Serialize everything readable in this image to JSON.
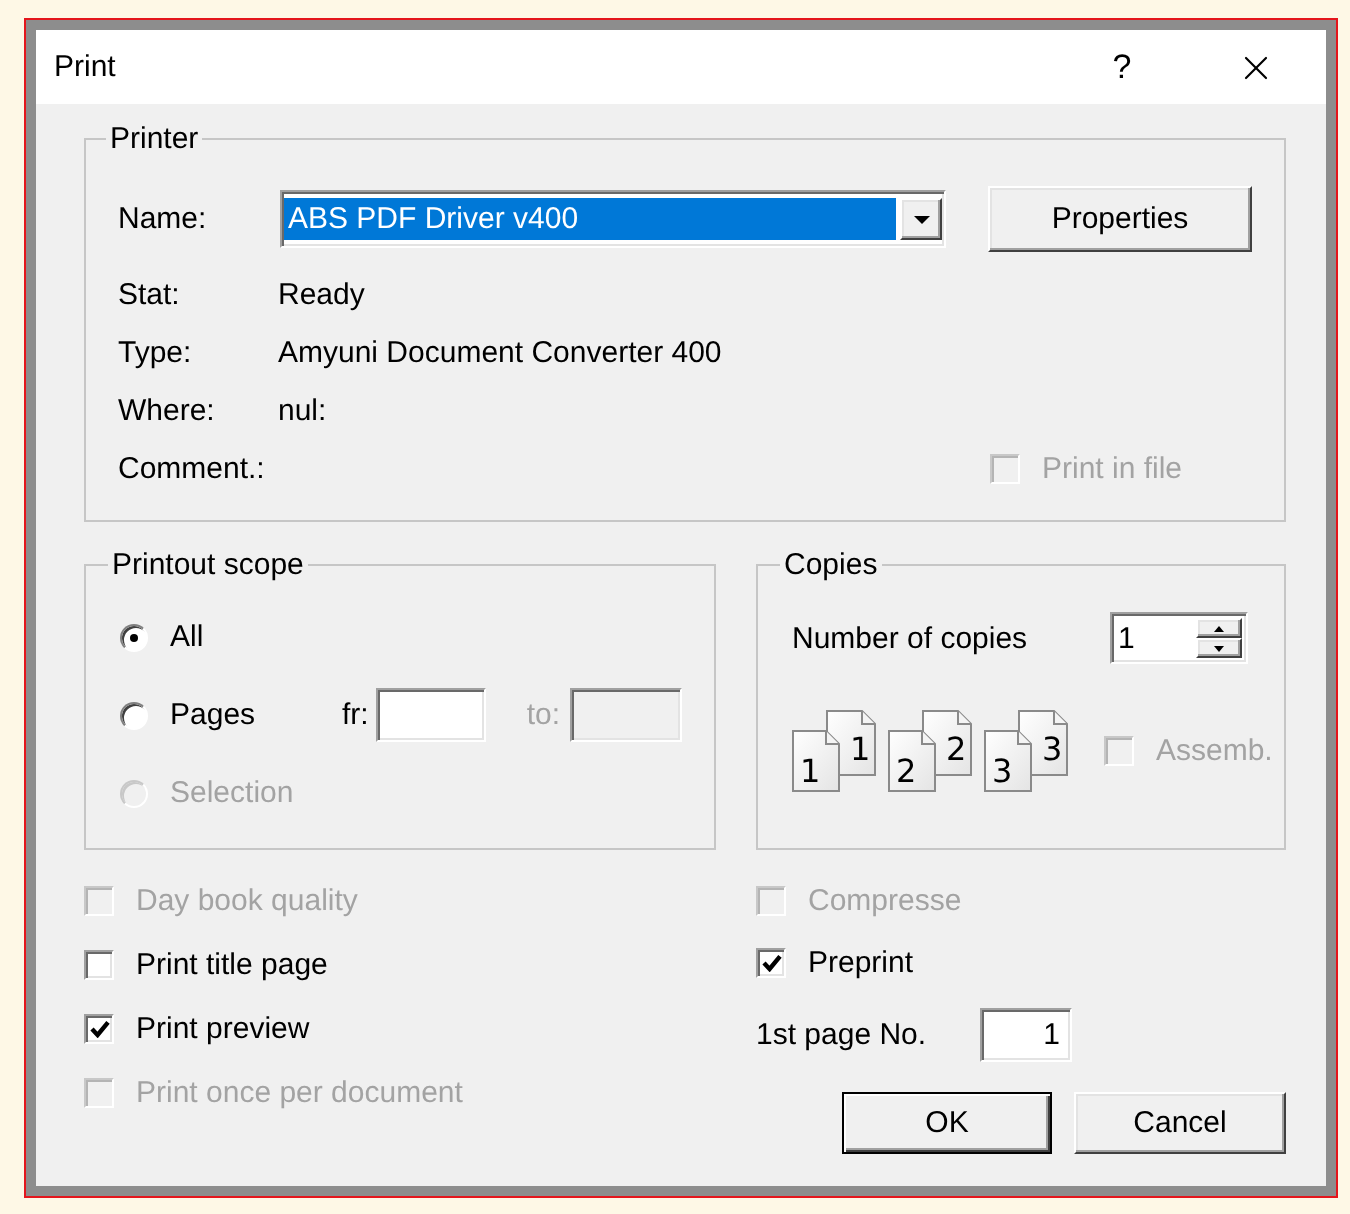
{
  "window": {
    "title": "Print",
    "help_button": "?"
  },
  "printer": {
    "legend": "Printer",
    "name_label": "Name:",
    "name_value": "ABS PDF Driver v400",
    "properties_button": "Properties",
    "info": [
      {
        "label": "Stat:",
        "value": "Ready"
      },
      {
        "label": "Type:",
        "value": "Amyuni Document Converter 400"
      },
      {
        "label": "Where:",
        "value": "nul:"
      },
      {
        "label": "Comment.:"
      }
    ],
    "print_in_file": {
      "label": "Print in file",
      "checked": false,
      "disabled": true
    }
  },
  "scope": {
    "legend": "Printout scope",
    "options": [
      {
        "label": "All",
        "selected": true,
        "disabled": false
      },
      {
        "label": "Pages",
        "selected": false,
        "disabled": false,
        "range": {
          "from": {
            "label": "fr:",
            "disabled": false
          },
          "to": {
            "label": "to:",
            "disabled": true
          }
        }
      },
      {
        "label": "Selection",
        "selected": false,
        "disabled": true
      }
    ]
  },
  "copies": {
    "legend": "Copies",
    "number_label": "Number of copies",
    "number_value": "1",
    "collate_pages": [
      {
        "front": "1",
        "back": "1"
      },
      {
        "front": "2",
        "back": "2"
      },
      {
        "front": "3",
        "back": "3"
      }
    ],
    "assemble": {
      "label": "Assemb.",
      "checked": false,
      "disabled": true
    }
  },
  "options_left": [
    {
      "label": "Day book quality",
      "checked": false,
      "disabled": true
    },
    {
      "label": "Print title page",
      "checked": false,
      "disabled": false
    },
    {
      "label": "Print preview",
      "checked": true,
      "disabled": false
    },
    {
      "label": "Print once per document",
      "checked": false,
      "disabled": true
    }
  ],
  "options_right": [
    {
      "label": "Compresse",
      "checked": false,
      "disabled": true
    },
    {
      "label": "Preprint",
      "checked": true,
      "disabled": false
    }
  ],
  "first_page": {
    "label": "1st page No.",
    "value": "1"
  },
  "buttons": [
    {
      "label": "OK",
      "default": true
    },
    {
      "label": "Cancel",
      "default": false
    }
  ]
}
